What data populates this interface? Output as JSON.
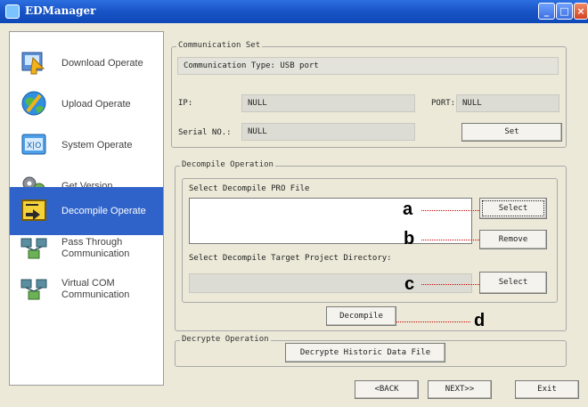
{
  "window": {
    "title": "EDManager"
  },
  "sidebar": {
    "items": [
      {
        "label": "Download Operate",
        "icon": "download-icon",
        "active": false
      },
      {
        "label": "Upload Operate",
        "icon": "upload-globe-icon",
        "active": false
      },
      {
        "label": "System Operate",
        "icon": "system-icon",
        "active": false
      },
      {
        "label": "Get Version",
        "icon": "version-gears-icon",
        "active": false
      },
      {
        "label": "Decompile Operate",
        "icon": "decompile-folder-icon",
        "active": true
      },
      {
        "label": "Pass Through Communication",
        "label_lines": [
          "Pass Through",
          "Communication"
        ],
        "icon": "network-icon",
        "active": false
      },
      {
        "label": "Virtual COM Communication",
        "label_lines": [
          "Virtual COM",
          "Communication"
        ],
        "icon": "network-icon",
        "active": false
      }
    ]
  },
  "communication": {
    "group_title": "Communication Set",
    "type_label": "Communication Type:",
    "type_value": "USB port",
    "ip_label": "IP:",
    "ip_value": "NULL",
    "port_label": "PORT:",
    "port_value": "NULL",
    "serial_label": "Serial NO.:",
    "serial_value": "NULL",
    "set_button": "Set"
  },
  "decompile": {
    "group_title": "Decompile Operation",
    "file_label": "Select Decompile PRO File",
    "select_button": "Select",
    "remove_button": "Remove",
    "dir_label": "Select Decompile Target Project Directory:",
    "dir_value": "",
    "dir_select_button": "Select",
    "decompile_button": "Decompile"
  },
  "decrypt": {
    "group_title": "Decrypte Operation",
    "button": "Decrypte Historic Data File"
  },
  "footer": {
    "back_button": "<BACK",
    "next_button": "NEXT>>",
    "exit_button": "Exit"
  },
  "annotations": {
    "a": "a",
    "b": "b",
    "c": "c",
    "d": "d"
  },
  "colors": {
    "title_bar": "#1a56c8",
    "active_item": "#2f63c9",
    "leader_line": "#cc0000",
    "window_bg": "#ece9d8"
  }
}
